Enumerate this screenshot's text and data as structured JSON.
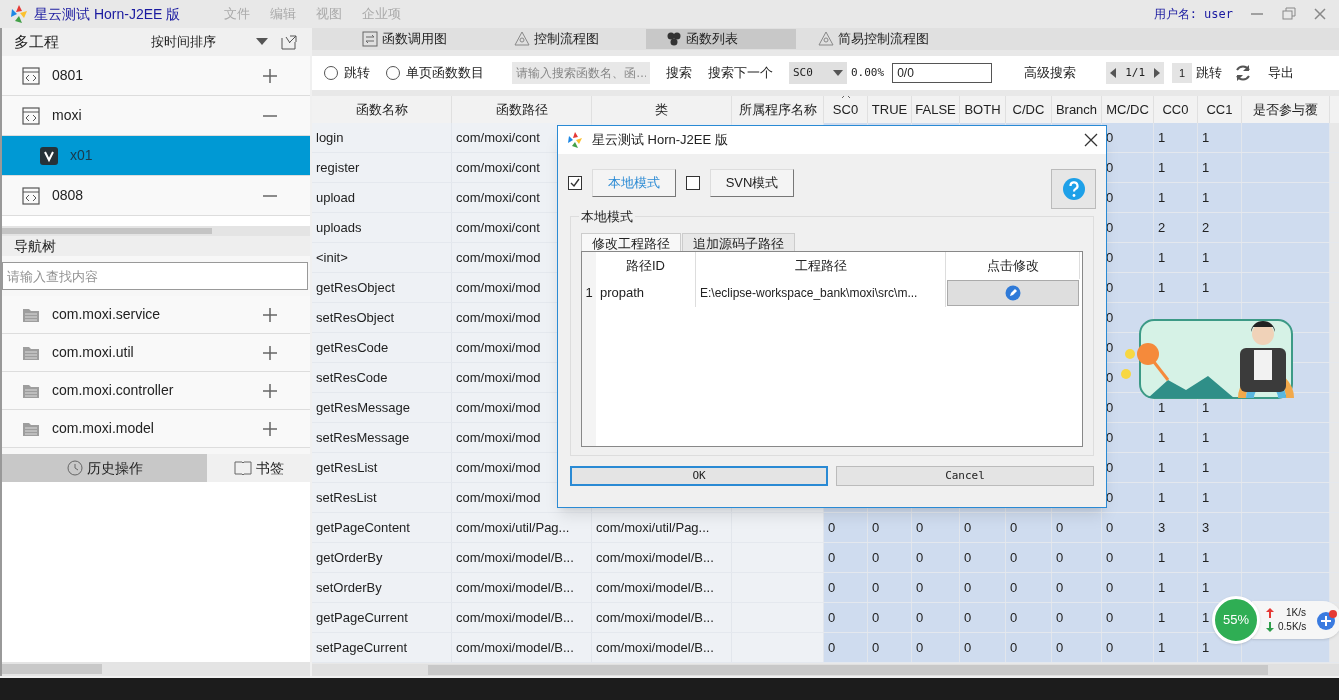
{
  "window": {
    "title": "星云测试 Horn-J2EE 版",
    "menu": [
      "文件",
      "编辑",
      "视图",
      "企业项"
    ],
    "user": "用户名: user"
  },
  "projects": {
    "title": "多工程",
    "sort": "按时间排序",
    "items": [
      {
        "label": "0801",
        "expanded": false,
        "selected": false
      },
      {
        "label": "moxi",
        "expanded": true,
        "selected": false,
        "children": [
          {
            "label": "x01",
            "selected": true
          }
        ]
      },
      {
        "label": "0808",
        "expanded": true,
        "selected": false
      }
    ]
  },
  "nav_tree": {
    "title": "导航树",
    "search_placeholder": "请输入查找内容",
    "items": [
      {
        "label": "com.moxi.service",
        "expanded": false
      },
      {
        "label": "com.moxi.util",
        "expanded": false
      },
      {
        "label": "com.moxi.controller",
        "expanded": false
      },
      {
        "label": "com.moxi.model",
        "expanded": false
      }
    ]
  },
  "bottom_tabs": [
    {
      "label": "历史操作",
      "selected": true
    },
    {
      "label": "书签",
      "selected": false
    }
  ],
  "view_tabs": [
    {
      "label": "函数调用图",
      "selected": false
    },
    {
      "label": "控制流程图",
      "selected": false
    },
    {
      "label": "函数列表",
      "selected": true
    },
    {
      "label": "简易控制流程图",
      "selected": false
    }
  ],
  "toolbar": {
    "radios": [
      {
        "label": "跳转",
        "selected": false
      },
      {
        "label": "单页函数数目",
        "selected": false
      }
    ],
    "search_placeholder": "请输入搜索函数名、函…",
    "search": "搜索",
    "search_next": "搜索下一个",
    "metric": "SC0",
    "percent": "0.00%",
    "count": "0/0",
    "advanced": "高级搜索",
    "page": "1/1",
    "page_input": "1",
    "jump": "跳转",
    "export": "导出"
  },
  "table": {
    "columns": [
      {
        "label": "函数名称",
        "sorted": false
      },
      {
        "label": "函数路径",
        "sorted": false
      },
      {
        "label": "类",
        "sorted": false
      },
      {
        "label": "所属程序名称",
        "sorted": false
      },
      {
        "label": "SC0",
        "sorted": true
      },
      {
        "label": "TRUE",
        "sorted": false
      },
      {
        "label": "FALSE",
        "sorted": false
      },
      {
        "label": "BOTH",
        "sorted": false
      },
      {
        "label": "C/DC",
        "sorted": false
      },
      {
        "label": "Branch",
        "sorted": false
      },
      {
        "label": "MC/DC",
        "sorted": false
      },
      {
        "label": "CC0",
        "sorted": false
      },
      {
        "label": "CC1",
        "sorted": false
      },
      {
        "label": "是否参与覆",
        "sorted": false
      }
    ],
    "rows": [
      {
        "cells": [
          "login",
          "com/moxi/cont",
          null,
          null,
          null,
          null,
          null,
          null,
          null,
          null,
          "0",
          "1",
          "1",
          null
        ]
      },
      {
        "cells": [
          "register",
          "com/moxi/cont",
          null,
          null,
          null,
          null,
          null,
          null,
          null,
          null,
          "0",
          "1",
          "1",
          null
        ]
      },
      {
        "cells": [
          "upload",
          "com/moxi/cont",
          null,
          null,
          null,
          null,
          null,
          null,
          null,
          null,
          "0",
          "1",
          "1",
          null
        ]
      },
      {
        "cells": [
          "uploads",
          "com/moxi/cont",
          null,
          null,
          null,
          null,
          null,
          null,
          null,
          null,
          "0",
          "2",
          "2",
          null
        ]
      },
      {
        "cells": [
          "<init>",
          "com/moxi/mod",
          null,
          null,
          null,
          null,
          null,
          null,
          null,
          null,
          "0",
          "1",
          "1",
          null
        ]
      },
      {
        "cells": [
          "getResObject",
          "com/moxi/mod",
          null,
          null,
          null,
          null,
          null,
          null,
          null,
          null,
          "0",
          "1",
          "1",
          null
        ]
      },
      {
        "cells": [
          "setResObject",
          "com/moxi/mod",
          null,
          null,
          null,
          null,
          null,
          null,
          null,
          null,
          "0",
          null,
          null,
          null
        ]
      },
      {
        "cells": [
          "getResCode",
          "com/moxi/mod",
          null,
          null,
          null,
          null,
          null,
          null,
          null,
          null,
          "0",
          null,
          null,
          null
        ]
      },
      {
        "cells": [
          "setResCode",
          "com/moxi/mod",
          null,
          null,
          null,
          null,
          null,
          null,
          null,
          null,
          "0",
          null,
          null,
          null
        ]
      },
      {
        "cells": [
          "getResMessage",
          "com/moxi/mod",
          null,
          null,
          null,
          null,
          null,
          null,
          null,
          null,
          "0",
          "1",
          "1",
          null
        ]
      },
      {
        "cells": [
          "setResMessage",
          "com/moxi/mod",
          null,
          null,
          null,
          null,
          null,
          null,
          null,
          null,
          "0",
          "1",
          "1",
          null
        ]
      },
      {
        "cells": [
          "getResList",
          "com/moxi/mod",
          null,
          null,
          null,
          null,
          null,
          null,
          null,
          null,
          "0",
          "1",
          "1",
          null
        ]
      },
      {
        "cells": [
          "setResList",
          "com/moxi/mod",
          null,
          null,
          null,
          null,
          null,
          null,
          null,
          null,
          "0",
          "1",
          "1",
          null
        ]
      },
      {
        "cells": [
          "getPageContent",
          "com/moxi/util/Pag...",
          "com/moxi/util/Pag...",
          null,
          "0",
          "0",
          "0",
          "0",
          "0",
          "0",
          "0",
          "3",
          "3",
          null
        ]
      },
      {
        "cells": [
          "getOrderBy",
          "com/moxi/model/B...",
          "com/moxi/model/B...",
          null,
          "0",
          "0",
          "0",
          "0",
          "0",
          "0",
          "0",
          "1",
          "1",
          null
        ]
      },
      {
        "cells": [
          "setOrderBy",
          "com/moxi/model/B...",
          "com/moxi/model/B...",
          null,
          "0",
          "0",
          "0",
          "0",
          "0",
          "0",
          "0",
          "1",
          "1",
          null
        ]
      },
      {
        "cells": [
          "getPageCurrent",
          "com/moxi/model/B...",
          "com/moxi/model/B...",
          null,
          "0",
          "0",
          "0",
          "0",
          "0",
          "0",
          "0",
          "1",
          "1",
          null
        ]
      },
      {
        "cells": [
          "setPageCurrent",
          "com/moxi/model/B...",
          "com/moxi/model/B...",
          null,
          "0",
          "0",
          "0",
          "0",
          "0",
          "0",
          "0",
          "1",
          "1",
          null
        ]
      }
    ]
  },
  "dialog": {
    "title": "星云测试 Horn-J2EE 版",
    "modes": [
      {
        "label": "本地模式",
        "checked": true
      },
      {
        "label": "SVN模式",
        "checked": false
      }
    ],
    "group": "本地模式",
    "tabs": [
      {
        "label": "修改工程路径",
        "selected": true
      },
      {
        "label": "追加源码子路径",
        "selected": false
      }
    ],
    "columns": [
      "路径ID",
      "工程路径",
      "点击修改"
    ],
    "rows": [
      {
        "index": "1",
        "id": "propath",
        "path": "E:\\eclipse-workspace_bank\\moxi\\src\\m..."
      }
    ],
    "ok": "OK",
    "cancel": "Cancel"
  },
  "net_widget": {
    "memory": "55%",
    "up": "1K/s",
    "down": "0.5K/s"
  }
}
